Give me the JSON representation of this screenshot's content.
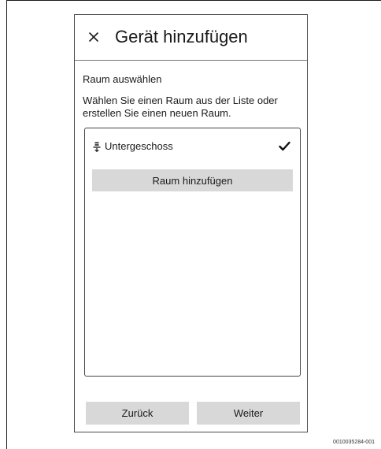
{
  "header": {
    "title": "Gerät hinzufügen",
    "close_icon": "close-icon"
  },
  "room_selection": {
    "section_label": "Raum auswählen",
    "description": "Wählen Sie einen Raum aus der Liste oder erstellen Sie einen neuen Raum.",
    "rooms": [
      {
        "label": "Untergeschoss",
        "icon": "basement-floor-icon",
        "selected": true,
        "selected_icon": "checkmark-icon"
      }
    ],
    "add_room_label": "Raum hinzufügen"
  },
  "footer": {
    "back_label": "Zurück",
    "next_label": "Weiter"
  },
  "figure_id": "0010035284-001",
  "colors": {
    "button_background": "#d8d8d8",
    "border": "#444444",
    "text": "#1a1a1a"
  }
}
